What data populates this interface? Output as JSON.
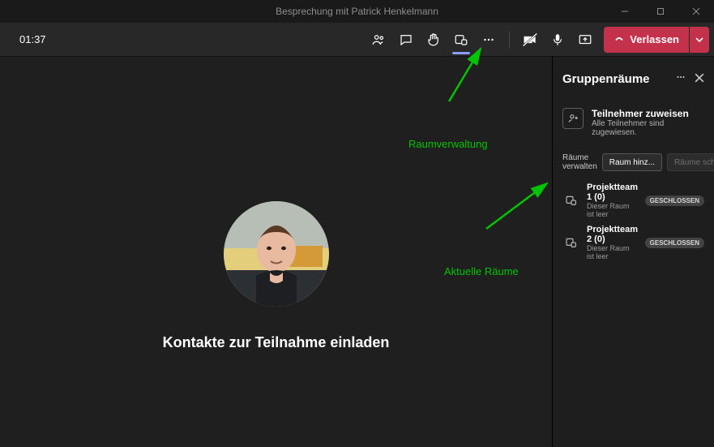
{
  "titlebar": {
    "title": "Besprechung mit Patrick Henkelmann"
  },
  "toolbar": {
    "timer": "01:37",
    "leave_label": "Verlassen"
  },
  "main": {
    "invite_text": "Kontakte zur Teilnahme einladen"
  },
  "panel": {
    "title": "Gruppenräume",
    "assign_title": "Teilnehmer zuweisen",
    "assign_sub": "Alle Teilnehmer sind zugewiesen.",
    "manage_label": "Räume verwalten",
    "add_btn": "Raum hinz...",
    "close_btn": "Räume schl...",
    "rooms": [
      {
        "name": "Projektteam 1 (0)",
        "sub": "Dieser Raum ist leer",
        "badge": "GESCHLOSSEN"
      },
      {
        "name": "Projektteam 2 (0)",
        "sub": "Dieser Raum ist leer",
        "badge": "GESCHLOSSEN"
      }
    ]
  },
  "annotations": {
    "label1": "Raumverwaltung",
    "label2": "Aktuelle Räume"
  }
}
